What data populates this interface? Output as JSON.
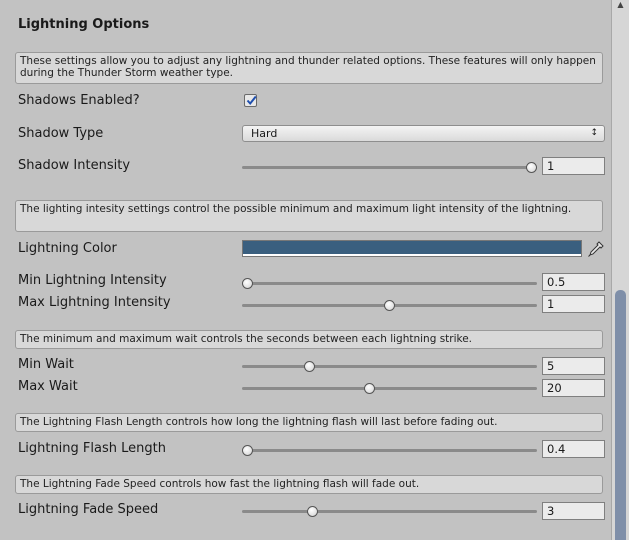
{
  "title": "Lightning Options",
  "help": {
    "intro": "These settings allow you to adjust any lightning and thunder related options. These features will only happen during the Thunder Storm weather type.",
    "intensity": "The lighting intesity settings control the possible minimum and maximum light intensity of the lightning.",
    "wait": "The minimum and maximum wait controls the seconds between each lightning strike.",
    "flash": "The Lightning Flash Length controls how long the lightning flash will last before fading out.",
    "fade": "The Lightning Fade Speed controls how fast the lightning flash will fade out."
  },
  "shadows_enabled": {
    "label": "Shadows Enabled?",
    "checked": true
  },
  "shadow_type": {
    "label": "Shadow Type",
    "value": "Hard"
  },
  "shadow_intensity": {
    "label": "Shadow Intensity",
    "value": "1",
    "level": 1.0
  },
  "lightning_color": {
    "label": "Lightning Color",
    "color": "#3a5f7f"
  },
  "min_lightning_intensity": {
    "label": "Min Lightning Intensity",
    "value": "0.5",
    "level": 0.0
  },
  "max_lightning_intensity": {
    "label": "Max Lightning Intensity",
    "value": "1",
    "level": 0.5
  },
  "min_wait": {
    "label": "Min Wait",
    "value": "5",
    "level": 0.22
  },
  "max_wait": {
    "label": "Max Wait",
    "value": "20",
    "level": 0.43
  },
  "flash_length": {
    "label": "Lightning Flash Length",
    "value": "0.4",
    "level": 0.0
  },
  "fade_speed": {
    "label": "Lightning Fade Speed",
    "value": "3",
    "level": 0.23
  },
  "icons": {
    "checkbox": "check-icon",
    "dropdown": "up-down-arrows-icon",
    "picker": "eyedropper-icon",
    "scroll": "scroll-up-arrow-icon"
  }
}
